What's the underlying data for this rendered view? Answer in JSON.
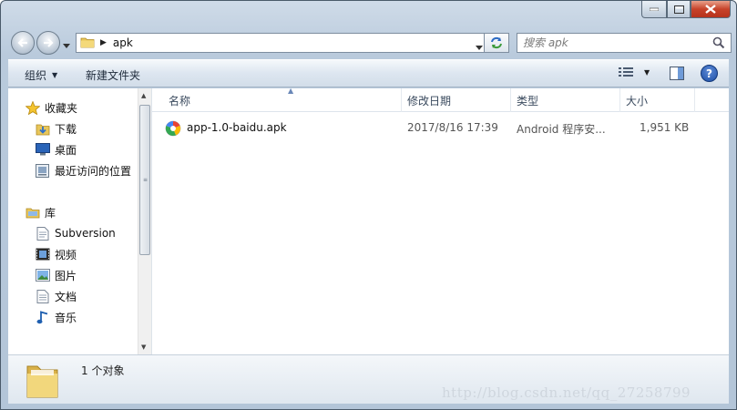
{
  "window": {
    "controls": {
      "minimize": "minimize-icon",
      "maximize": "maximize-icon",
      "close": "close-icon"
    }
  },
  "address": {
    "path": "apk"
  },
  "search": {
    "placeholder": "搜索 apk"
  },
  "toolbar": {
    "organize_label": "组织",
    "new_folder_label": "新建文件夹"
  },
  "nav": {
    "favorites": {
      "label": "收藏夹",
      "items": [
        {
          "label": "下载",
          "icon": "download-folder-icon"
        },
        {
          "label": "桌面",
          "icon": "desktop-icon"
        },
        {
          "label": "最近访问的位置",
          "icon": "recent-places-icon"
        }
      ]
    },
    "libraries": {
      "label": "库",
      "items": [
        {
          "label": "Subversion",
          "icon": "document-library-icon"
        },
        {
          "label": "视频",
          "icon": "video-icon"
        },
        {
          "label": "图片",
          "icon": "picture-icon"
        },
        {
          "label": "文档",
          "icon": "document-icon"
        },
        {
          "label": "音乐",
          "icon": "music-icon"
        }
      ]
    }
  },
  "columns": {
    "name": "名称",
    "date": "修改日期",
    "type": "类型",
    "size": "大小"
  },
  "files": [
    {
      "name": "app-1.0-baidu.apk",
      "date": "2017/8/16 17:39",
      "type": "Android 程序安...",
      "size": "1,951 KB"
    }
  ],
  "status": {
    "count": "1 个对象"
  },
  "watermark": "http://blog.csdn.net/qq_27258799",
  "colors": {
    "accent": "#1d4fa6",
    "close": "#c7432a"
  }
}
